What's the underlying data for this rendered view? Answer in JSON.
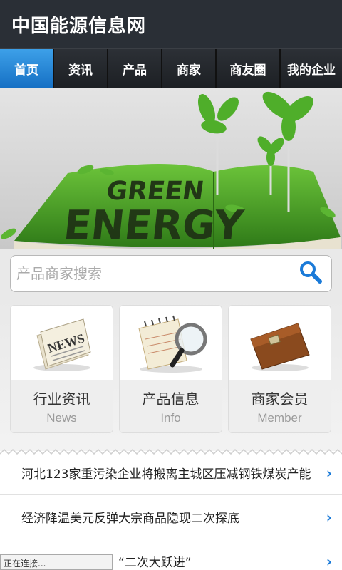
{
  "header": {
    "title": "中国能源信息网"
  },
  "nav": {
    "items": [
      {
        "label": "首页",
        "active": true
      },
      {
        "label": "资讯",
        "active": false
      },
      {
        "label": "产品",
        "active": false
      },
      {
        "label": "商家",
        "active": false
      },
      {
        "label": "商友圈",
        "active": false
      },
      {
        "label": "我的企业",
        "active": false
      }
    ]
  },
  "banner": {
    "text_line1": "GREEN",
    "text_line2": "ENERGY"
  },
  "search": {
    "placeholder": "产品商家搜索"
  },
  "cards": [
    {
      "title": "行业资讯",
      "subtitle": "News",
      "icon": "newspaper-icon"
    },
    {
      "title": "产品信息",
      "subtitle": "Info",
      "icon": "notepad-magnifier-icon"
    },
    {
      "title": "商家会员",
      "subtitle": "Member",
      "icon": "briefcase-icon"
    }
  ],
  "news": [
    {
      "title": "河北123家重污染企业将搬离主城区压减钢铁煤炭产能"
    },
    {
      "title": "经济降温美元反弹大宗商品隐现二次探底"
    },
    {
      "title": "“二次大跃进”"
    }
  ],
  "status": {
    "text": "正在连接..."
  },
  "colors": {
    "header_bg": "#2a2f36",
    "nav_active": "#1670c4",
    "accent": "#1a7ad8"
  }
}
